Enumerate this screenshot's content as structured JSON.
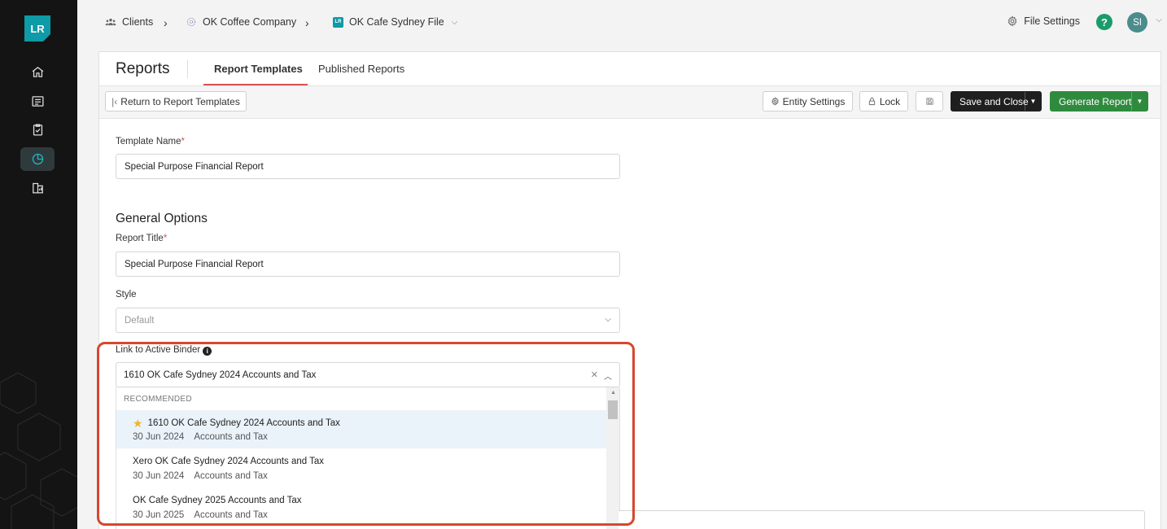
{
  "sidebar": {
    "logo": "LR",
    "items": [
      {
        "icon": "home-icon",
        "active": false
      },
      {
        "icon": "document-icon",
        "active": false
      },
      {
        "icon": "clipboard-check-icon",
        "active": false
      },
      {
        "icon": "pie-chart-icon",
        "active": true
      },
      {
        "icon": "building-chart-icon",
        "active": false
      }
    ]
  },
  "breadcrumb": {
    "clients": "Clients",
    "company": "OK Coffee Company",
    "file_badge": "LR",
    "file": "OK Cafe Sydney File"
  },
  "header": {
    "file_settings": "File Settings",
    "help": "?",
    "avatar": "SI"
  },
  "card": {
    "title": "Reports",
    "tabs": [
      "Report Templates",
      "Published Reports"
    ],
    "active_tab": "Report Templates"
  },
  "toolbar": {
    "return_label": "Return to Report Templates",
    "entity_settings": "Entity Settings",
    "lock": "Lock",
    "save_close": "Save and Close",
    "generate": "Generate Report"
  },
  "form": {
    "template_name_label": "Template Name",
    "template_name_value": "Special Purpose Financial Report",
    "section_title": "General Options",
    "report_title_label": "Report Title",
    "report_title_value": "Special Purpose Financial Report",
    "style_label": "Style",
    "style_value": "Default",
    "binder_label": "Link to Active Binder",
    "binder_value": "1610 OK Cafe Sydney 2024 Accounts and Tax"
  },
  "binder_menu": {
    "group": "RECOMMENDED",
    "options": [
      {
        "title": "1610 OK Cafe Sydney 2024 Accounts and Tax",
        "date": "30 Jun 2024",
        "type": "Accounts and Tax",
        "starred": true
      },
      {
        "title": "Xero OK Cafe Sydney 2024 Accounts and Tax",
        "date": "30 Jun 2024",
        "type": "Accounts and Tax",
        "starred": false
      },
      {
        "title": "OK Cafe Sydney 2025 Accounts and Tax",
        "date": "30 Jun 2025",
        "type": "Accounts and Tax",
        "starred": false
      }
    ]
  },
  "colors": {
    "brand": "#0e9aa7",
    "highlight": "#d7472f",
    "generate": "#2e8b3e",
    "tab_underline": "#d9534f"
  }
}
